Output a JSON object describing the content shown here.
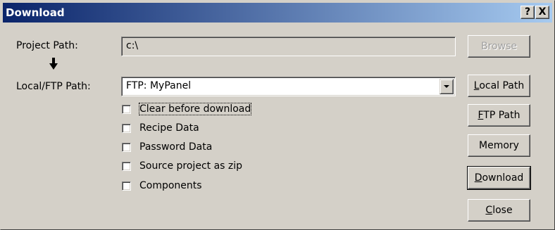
{
  "window": {
    "title": "Download",
    "help_label": "?",
    "close_label": "X"
  },
  "form": {
    "project_path_label": "Project Path:",
    "project_path_value": "c:\\",
    "local_ftp_label": "Local/FTP Path:",
    "local_ftp_value": "FTP: MyPanel",
    "arrow_icon": "down-arrow-icon"
  },
  "options": [
    {
      "label": "Clear before download",
      "checked": false
    },
    {
      "label": "Recipe Data",
      "checked": false
    },
    {
      "label": "Password Data",
      "checked": false
    },
    {
      "label": "Source project as zip",
      "checked": false
    },
    {
      "label": "Components",
      "checked": false
    }
  ],
  "buttons": {
    "browse": "Browse",
    "local_path_mnemonic": "L",
    "local_path_rest": "ocal Path",
    "ftp_path_mnemonic": "F",
    "ftp_path_rest": "TP Path",
    "memory": "Memory",
    "download_mnemonic": "D",
    "download_rest": "ownload",
    "close_mnemonic": "C",
    "close_rest": "lose"
  }
}
